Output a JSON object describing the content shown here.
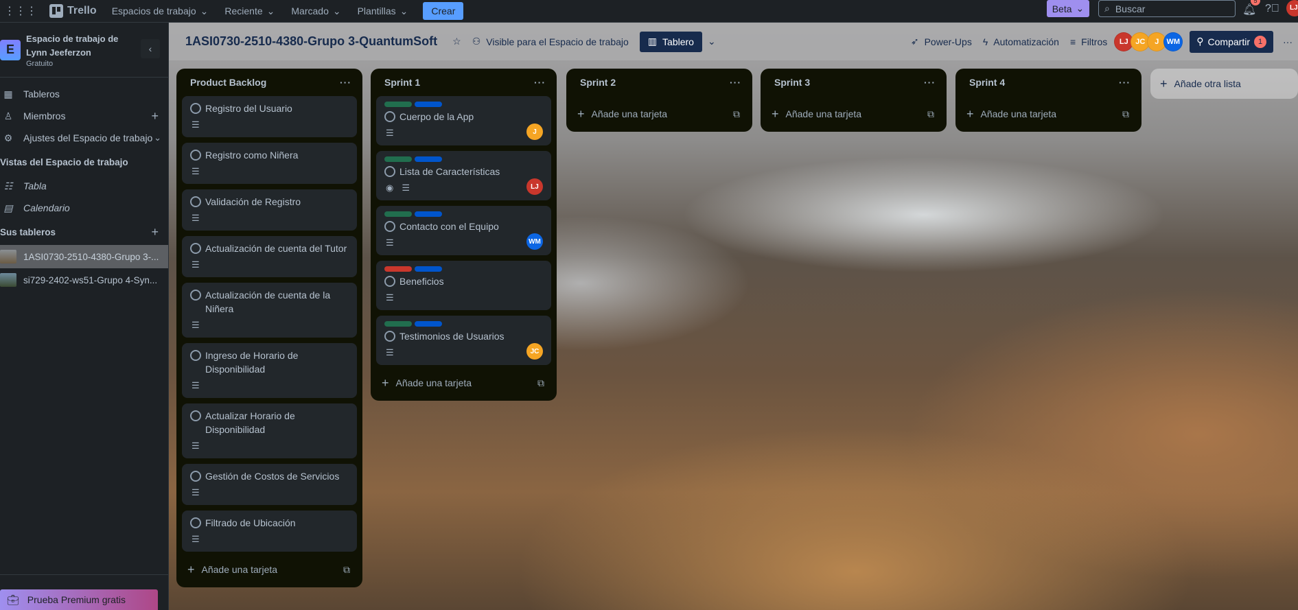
{
  "topbar": {
    "app": "Trello",
    "nav": [
      "Espacios de trabajo",
      "Reciente",
      "Marcado",
      "Plantillas"
    ],
    "create": "Crear",
    "beta": "Beta",
    "search_placeholder": "Buscar",
    "notifications": "5",
    "user_initials": "LJ"
  },
  "sidebar": {
    "workspace_initial": "E",
    "workspace_name": "Espacio de trabajo de Lynn Jeeferzon",
    "plan": "Gratuito",
    "items": [
      {
        "label": "Tableros"
      },
      {
        "label": "Miembros"
      },
      {
        "label": "Ajustes del Espacio de trabajo"
      }
    ],
    "views_heading": "Vistas del Espacio de trabajo",
    "views": [
      {
        "label": "Tabla"
      },
      {
        "label": "Calendario"
      }
    ],
    "boards_heading": "Sus tableros",
    "boards": [
      {
        "label": "1ASI0730-2510-4380-Grupo 3-..."
      },
      {
        "label": "si729-2402-ws51-Grupo 4-Syn..."
      }
    ],
    "premium": "Prueba Premium gratis"
  },
  "board": {
    "title": "1ASI0730-2510-4380-Grupo 3-QuantumSoft",
    "visibility": "Visible para el Espacio de trabajo",
    "view": "Tablero",
    "powerups": "Power-Ups",
    "automation": "Automatización",
    "filters": "Filtros",
    "share": "Compartir",
    "share_count": "1",
    "members": [
      {
        "initials": "LJ",
        "color": "#c9372c"
      },
      {
        "initials": "JC",
        "color": "#f5a524"
      },
      {
        "initials": "J",
        "color": "#f5a524"
      },
      {
        "initials": "WM",
        "color": "#0c66e4"
      }
    ]
  },
  "colors": {
    "green": "#216e4e",
    "blue": "#0055cc",
    "red": "#c9372c",
    "orange": "#f5a524"
  },
  "add_card": "Añade una tarjeta",
  "add_list": "Añade otra lista",
  "lists": [
    {
      "title": "Product Backlog",
      "cards": [
        {
          "title": "Registro del Usuario"
        },
        {
          "title": "Registro como Niñera"
        },
        {
          "title": "Validación de Registro"
        },
        {
          "title": "Actualización de cuenta del Tutor"
        },
        {
          "title": "Actualización de cuenta de la Niñera"
        },
        {
          "title": "Ingreso de Horario de Disponibilidad"
        },
        {
          "title": "Actualizar Horario de Disponibilidad"
        },
        {
          "title": "Gestión de Costos de Servicios"
        },
        {
          "title": "Filtrado de Ubicación"
        }
      ]
    },
    {
      "title": "Sprint 1",
      "cards": [
        {
          "title": "Cuerpo de la App",
          "labels": [
            "green",
            "blue"
          ],
          "member": "J",
          "member_color": "#f5a524"
        },
        {
          "title": "Lista de Características",
          "labels": [
            "green",
            "blue"
          ],
          "watching": true,
          "member": "LJ",
          "member_color": "#c9372c"
        },
        {
          "title": "Contacto con el Equipo",
          "labels": [
            "green",
            "blue"
          ],
          "member": "WM",
          "member_color": "#0c66e4"
        },
        {
          "title": "Beneficios",
          "labels": [
            "red",
            "blue"
          ]
        },
        {
          "title": "Testimonios de Usuarios",
          "labels": [
            "green",
            "blue"
          ],
          "member": "JC",
          "member_color": "#f5a524"
        }
      ]
    },
    {
      "title": "Sprint 2",
      "cards": []
    },
    {
      "title": "Sprint 3",
      "cards": []
    },
    {
      "title": "Sprint 4",
      "cards": []
    }
  ]
}
